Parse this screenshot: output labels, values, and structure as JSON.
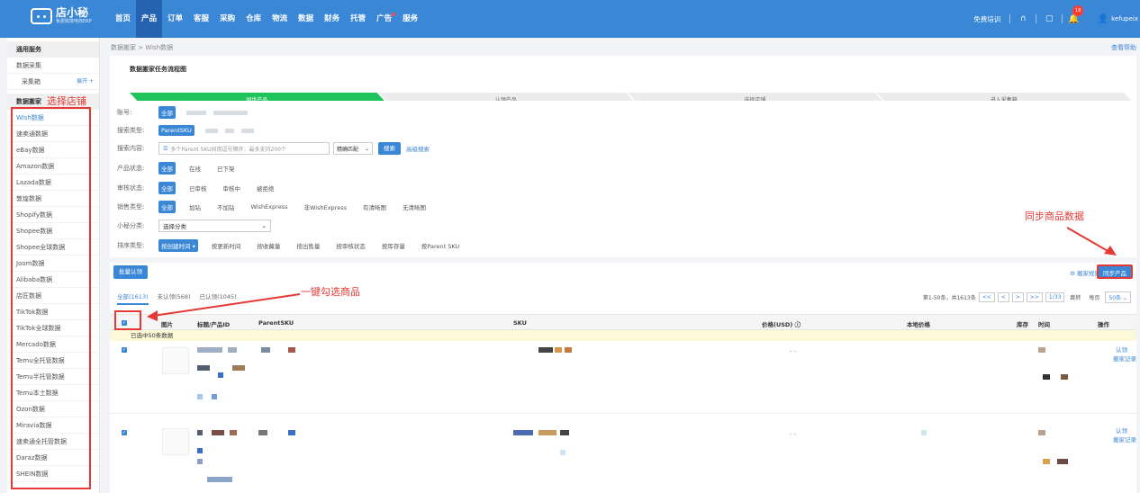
{
  "topbar": {
    "logo_name": "店小秘",
    "logo_sub": "免费跨境电商ERP",
    "nav": [
      {
        "label": "首页"
      },
      {
        "label": "产品",
        "active": true
      },
      {
        "label": "订单"
      },
      {
        "label": "客服"
      },
      {
        "label": "采购"
      },
      {
        "label": "仓库"
      },
      {
        "label": "物流"
      },
      {
        "label": "数据"
      },
      {
        "label": "财务"
      },
      {
        "label": "托管"
      },
      {
        "label": "广告",
        "dot": true
      },
      {
        "label": "服务"
      }
    ],
    "training": "免费培训",
    "badge": "18",
    "username": "kefupeix"
  },
  "sidebar": {
    "sec1": "通用服务",
    "collect": "数据采集",
    "collect_box": "采集箱",
    "expand": "展开 +",
    "sec2": "数据搬家",
    "items": [
      "Wish数据",
      "速卖通数据",
      "eBay数据",
      "Amazon数据",
      "Lazada数据",
      "敦煌数据",
      "Shopify数据",
      "Shopee数据",
      "Shopee全球数据",
      "Joom数据",
      "Alibaba数据",
      "店匠数据",
      "TikTok数据",
      "TikTok全球数据",
      "Mercado数据",
      "Temu全托管数据",
      "Temu半托管数据",
      "Temu本土数据",
      "Ozon数据",
      "Miravia数据",
      "速卖通全托管数据",
      "Daraz数据",
      "SHEIN数据"
    ]
  },
  "breadcrumb": {
    "a": "数据搬家",
    "sep": ">",
    "b": "Wish数据"
  },
  "help": "查看帮助",
  "flow": {
    "title": "数据搬家任务流程图",
    "steps": [
      "同步产品",
      "认领产品",
      "选择店铺",
      "进入采集箱"
    ]
  },
  "filters": {
    "account": {
      "label": "账号:",
      "all": "全部"
    },
    "search_type": {
      "label": "搜索类型:",
      "sel": "ParentSKU"
    },
    "search": {
      "label": "搜索内容:",
      "placeholder": "多个Parent SKU间用逗号隔开，最多支持200个",
      "match": "精确匹配",
      "btn": "搜索",
      "adv": "高级搜索"
    },
    "product_status": {
      "label": "产品状态:",
      "opts": [
        "全部",
        "在线",
        "已下架"
      ]
    },
    "audit_status": {
      "label": "审核状态:",
      "opts": [
        "全部",
        "已审核",
        "审核中",
        "被拒绝"
      ]
    },
    "sale_type": {
      "label": "销售类型:",
      "opts": [
        "全部",
        "加钻",
        "不加钻",
        "WishExpress",
        "非WishExpress",
        "有清晰图",
        "无清晰图"
      ]
    },
    "category": {
      "label": "小秘分类:",
      "placeholder": "选择分类"
    },
    "sort": {
      "label": "排序类型:",
      "opts": [
        "按创建时间 ▾",
        "按更新时间",
        "按收藏量",
        "按出售量",
        "按审核状态",
        "按库存量",
        "按Parent SKU"
      ]
    }
  },
  "list": {
    "batch": "批量认领",
    "rules": "搬家规则",
    "sync": "同步产品",
    "tabs": [
      "全部(1613)",
      "未认领(568)",
      "已认领(1045)"
    ],
    "pager": {
      "info": "第1-50条，共1613条",
      "first": "<<",
      "prev": "<",
      "next": ">",
      "last": ">>",
      "page": "1/33",
      "jump": "跳转",
      "per_label": "每页",
      "per": "50条"
    },
    "cols": [
      "图片",
      "标题/产品ID",
      "ParentSKU",
      "SKU",
      "价格(USD) ⓘ",
      "本地价格",
      "库存",
      "时间",
      "操作"
    ],
    "selected": "已选中50条数据",
    "rows": [
      {
        "a1": "认领",
        "a2": "搬家记录",
        "price": "- -"
      },
      {
        "a1": "认领",
        "a2": "搬家记录",
        "price": "- -"
      }
    ]
  },
  "annotations": {
    "shop": "选择店铺",
    "sync": "同步商品数据",
    "check": "一键勾选商品"
  }
}
